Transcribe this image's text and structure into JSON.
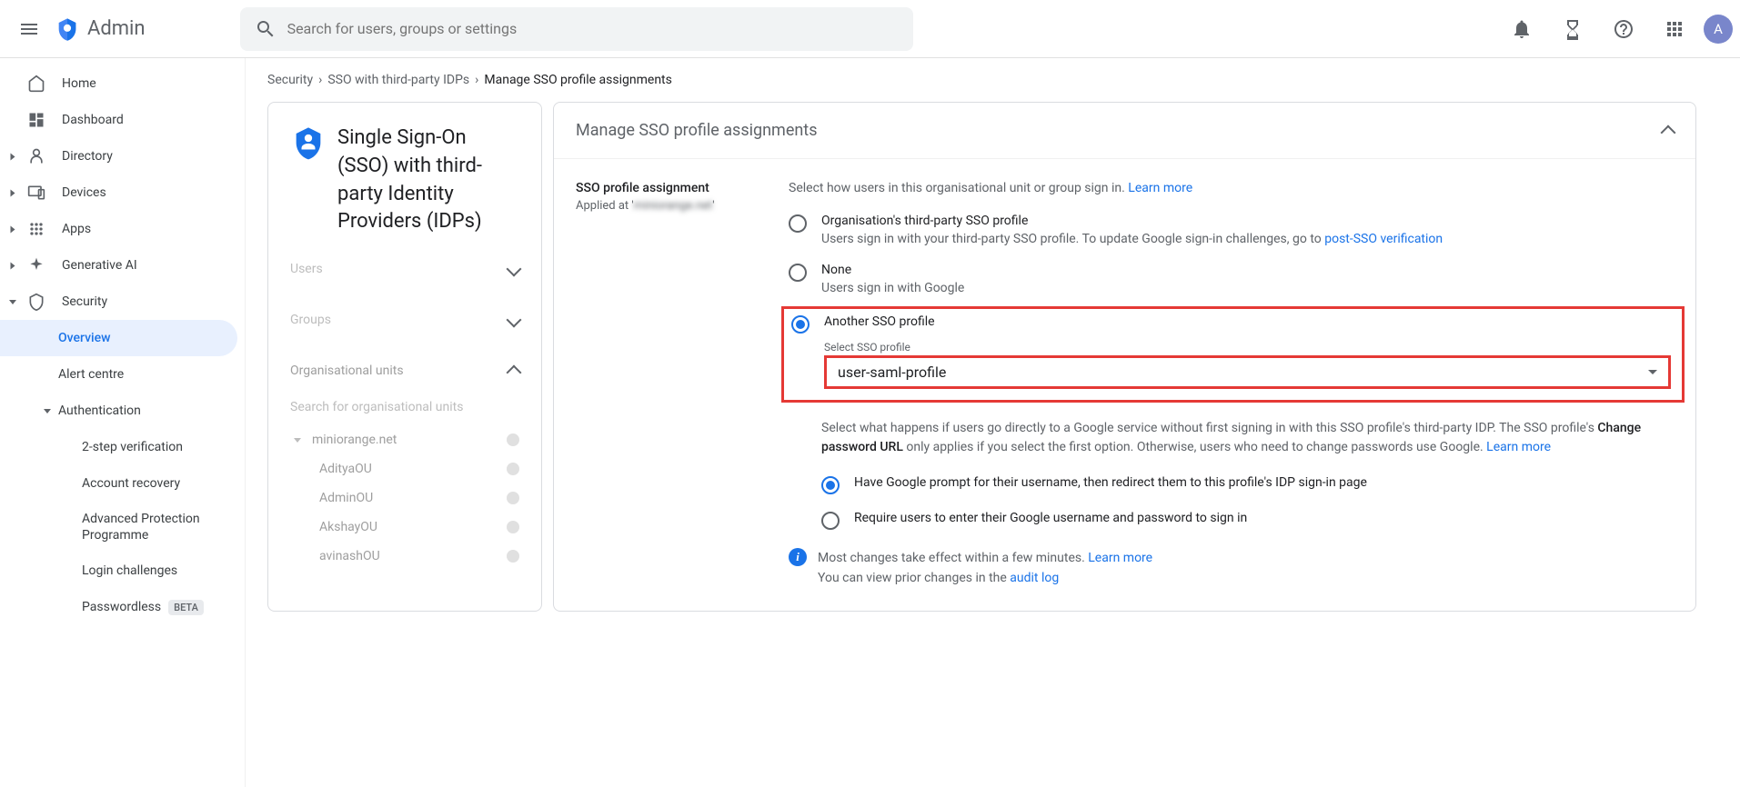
{
  "header": {
    "logo_label": "Admin",
    "search_placeholder": "Search for users, groups or settings",
    "avatar_initial": "A"
  },
  "sidebar": {
    "items": [
      {
        "label": "Home"
      },
      {
        "label": "Dashboard"
      },
      {
        "label": "Directory"
      },
      {
        "label": "Devices"
      },
      {
        "label": "Apps"
      },
      {
        "label": "Generative AI"
      },
      {
        "label": "Security"
      }
    ],
    "security_children": {
      "overview": "Overview",
      "alert_centre": "Alert centre",
      "authentication": "Authentication",
      "auth_children": [
        "2-step verification",
        "Account recovery",
        "Advanced Protection Programme",
        "Login challenges",
        "Passwordless"
      ],
      "beta_label": "BETA"
    }
  },
  "breadcrumb": {
    "a": "Security",
    "b": "SSO with third-party IDPs",
    "c": "Manage SSO profile assignments"
  },
  "left_panel": {
    "title": "Single Sign-On (SSO) with third-party Identity Providers (IDPs)",
    "sections": {
      "users": "Users",
      "groups": "Groups",
      "org_units": "Organisational units"
    },
    "ou_search_placeholder": "Search for organisational units",
    "ou_root": "miniorange.net",
    "ou_children": [
      "AdityaOU",
      "AdminOU",
      "AkshayOU",
      "avinashOU"
    ]
  },
  "right_panel": {
    "header": "Manage SSO profile assignments",
    "assignment_label": "SSO profile assignment",
    "applied_at_prefix": "Applied at '",
    "applied_at_value": "miniorange.net",
    "applied_at_suffix": "'",
    "help_text": "Select how users in this organisational unit or group sign in. ",
    "learn_more": "Learn more",
    "options": {
      "org_profile": {
        "label": "Organisation's third-party SSO profile",
        "desc_a": "Users sign in with your third-party SSO profile. To update Google sign-in challenges, go to ",
        "link": "post-SSO verification"
      },
      "none": {
        "label": "None",
        "desc": "Users sign in with Google"
      },
      "another": {
        "label": "Another SSO profile",
        "select_label": "Select SSO profile",
        "select_value": "user-saml-profile"
      }
    },
    "explain_a": "Select what happens if users go directly to a Google service without first signing in with this SSO profile's third-party IDP. The SSO profile's ",
    "explain_bold": "Change password URL",
    "explain_b": " only applies if you select the first option. Otherwise, users who need to change passwords use Google. ",
    "sub_options": {
      "prompt": "Have Google prompt for their username, then redirect them to this profile's IDP sign-in page",
      "require": "Require users to enter their Google username and password to sign in"
    },
    "info_a": "Most changes take effect within a few minutes. ",
    "info_b": "You can view prior changes in the ",
    "audit_link": "audit log"
  }
}
